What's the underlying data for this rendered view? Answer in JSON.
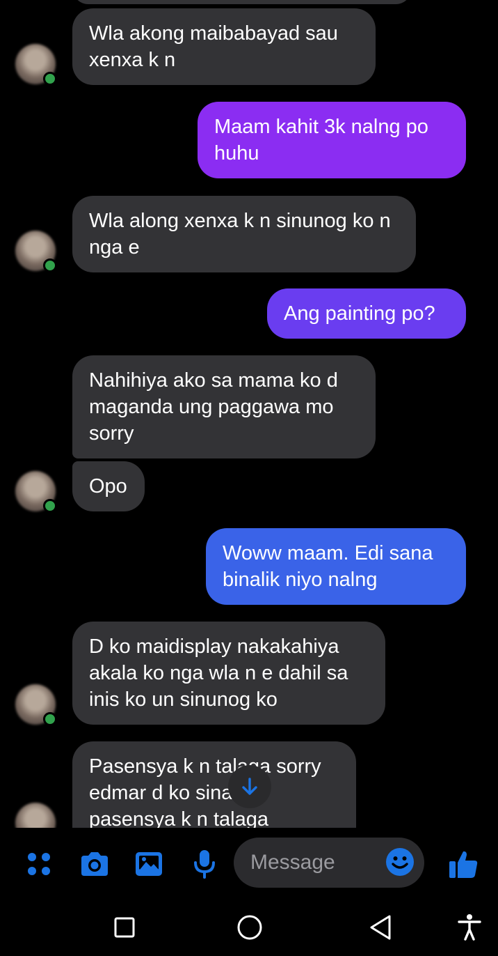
{
  "messages": [
    {
      "side": "in",
      "text": "Wla akong maibabayad sau xenxa k n"
    },
    {
      "side": "out",
      "text": "Maam kahit 3k nalng po huhu"
    },
    {
      "side": "in",
      "text": "Wla along xenxa k n sinunog ko n nga e"
    },
    {
      "side": "out",
      "text": "Ang painting po?"
    },
    {
      "side": "in",
      "text": "Nahihiya ako sa mama ko d maganda ung paggawa mo sorry"
    },
    {
      "side": "in",
      "text": "Opo"
    },
    {
      "side": "out",
      "text": "Woww maam. Edi sana binalik niyo nalng"
    },
    {
      "side": "in",
      "text": "D ko maidisplay nakakahiya akala ko nga wla n e dahil sa inis ko un sinunog ko"
    },
    {
      "side": "in",
      "text": "Pasensya k n talaga sorry edmar d ko sinadya pasensya k n talaga"
    }
  ],
  "composer": {
    "placeholder": "Message",
    "icons": [
      "menu-dots-icon",
      "camera-icon",
      "gallery-icon",
      "microphone-icon",
      "emoji-icon",
      "thumbs-up-icon"
    ]
  },
  "colors": {
    "incoming_bubble": "#333336",
    "outgoing_purple": "#8b2df2",
    "outgoing_violet": "#6a3df0",
    "outgoing_blue": "#3a63e8",
    "accent": "#1b74e4"
  },
  "navigation": {
    "icons": [
      "recents-icon",
      "home-icon",
      "back-icon",
      "accessibility-icon"
    ]
  }
}
